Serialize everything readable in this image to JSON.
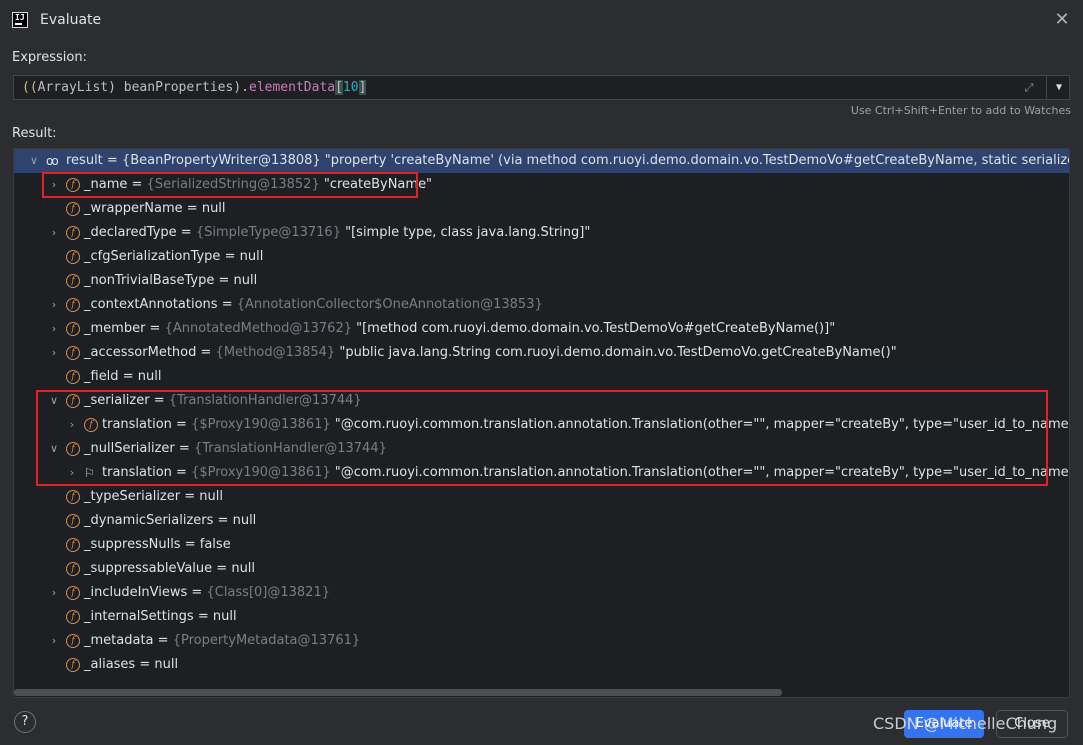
{
  "window": {
    "title": "Evaluate"
  },
  "expression": {
    "label": "Expression:",
    "parts": {
      "p1": "((",
      "cls": "ArrayList",
      "p2": ") beanProperties)",
      "dot": ".",
      "field": "elementData",
      "lb": "[",
      "idx": "10",
      "rb": "]"
    },
    "hint": "Use Ctrl+Shift+Enter to add to Watches"
  },
  "result": {
    "label": "Result:",
    "root": {
      "name": "result",
      "eq": " = ",
      "ref": "{BeanPropertyWriter@13808}",
      "value": " \"property 'createByName' (via method com.ruoyi.demo.domain.vo.TestDemoVo#getCreateByName, static serializer of type com"
    },
    "rows": [
      {
        "name": "_name",
        "eq": " = ",
        "ref": "{SerializedString@13852}",
        "value": " \"createByName\""
      },
      {
        "name": "_wrapperName",
        "eq": " = ",
        "ref": "",
        "value": "null"
      },
      {
        "name": "_declaredType",
        "eq": " = ",
        "ref": "{SimpleType@13716}",
        "value": " \"[simple type, class java.lang.String]\""
      },
      {
        "name": "_cfgSerializationType",
        "eq": " = ",
        "ref": "",
        "value": "null"
      },
      {
        "name": "_nonTrivialBaseType",
        "eq": " = ",
        "ref": "",
        "value": "null"
      },
      {
        "name": "_contextAnnotations",
        "eq": " = ",
        "ref": "{AnnotationCollector$OneAnnotation@13853}",
        "value": ""
      },
      {
        "name": "_member",
        "eq": " = ",
        "ref": "{AnnotatedMethod@13762}",
        "value": " \"[method com.ruoyi.demo.domain.vo.TestDemoVo#getCreateByName()]\""
      },
      {
        "name": "_accessorMethod",
        "eq": " = ",
        "ref": "{Method@13854}",
        "value": " \"public java.lang.String com.ruoyi.demo.domain.vo.TestDemoVo.getCreateByName()\""
      },
      {
        "name": "_field",
        "eq": " = ",
        "ref": "",
        "value": "null"
      },
      {
        "name": "_serializer",
        "eq": " = ",
        "ref": "{TranslationHandler@13744}",
        "value": ""
      },
      {
        "name": "translation",
        "eq": " = ",
        "ref": "{$Proxy190@13861}",
        "value": " \"@com.ruoyi.common.translation.annotation.Translation(other=\"\", mapper=\"createBy\", type=\"user_id_to_name\")\""
      },
      {
        "name": "_nullSerializer",
        "eq": " = ",
        "ref": "{TranslationHandler@13744}",
        "value": ""
      },
      {
        "name": "translation",
        "eq": " = ",
        "ref": "{$Proxy190@13861}",
        "value": " \"@com.ruoyi.common.translation.annotation.Translation(other=\"\", mapper=\"createBy\", type=\"user_id_to_name\")\""
      },
      {
        "name": "_typeSerializer",
        "eq": " = ",
        "ref": "",
        "value": "null"
      },
      {
        "name": "_dynamicSerializers",
        "eq": " = ",
        "ref": "",
        "value": "null"
      },
      {
        "name": "_suppressNulls",
        "eq": " = ",
        "ref": "",
        "value": "false"
      },
      {
        "name": "_suppressableValue",
        "eq": " = ",
        "ref": "",
        "value": "null"
      },
      {
        "name": "_includeInViews",
        "eq": " = ",
        "ref": "{Class[0]@13821}",
        "value": ""
      },
      {
        "name": "_internalSettings",
        "eq": " = ",
        "ref": "",
        "value": "null"
      },
      {
        "name": "_metadata",
        "eq": " = ",
        "ref": "{PropertyMetadata@13761}",
        "value": ""
      },
      {
        "name": "_aliases",
        "eq": " = ",
        "ref": "",
        "value": "null"
      }
    ]
  },
  "icons": {
    "field": "f",
    "help": "?",
    "close": "✕",
    "expand": "⤢",
    "dropdown": "▼",
    "watch": "oo",
    "flag": "⚐"
  },
  "buttons": {
    "evaluate": "Evaluate",
    "close": "Close"
  },
  "watermark": "CSDN @MichelleChung",
  "colors": {
    "accent": "#3574f0",
    "highlight_box": "#e0222b",
    "selection": "#2e436e"
  }
}
